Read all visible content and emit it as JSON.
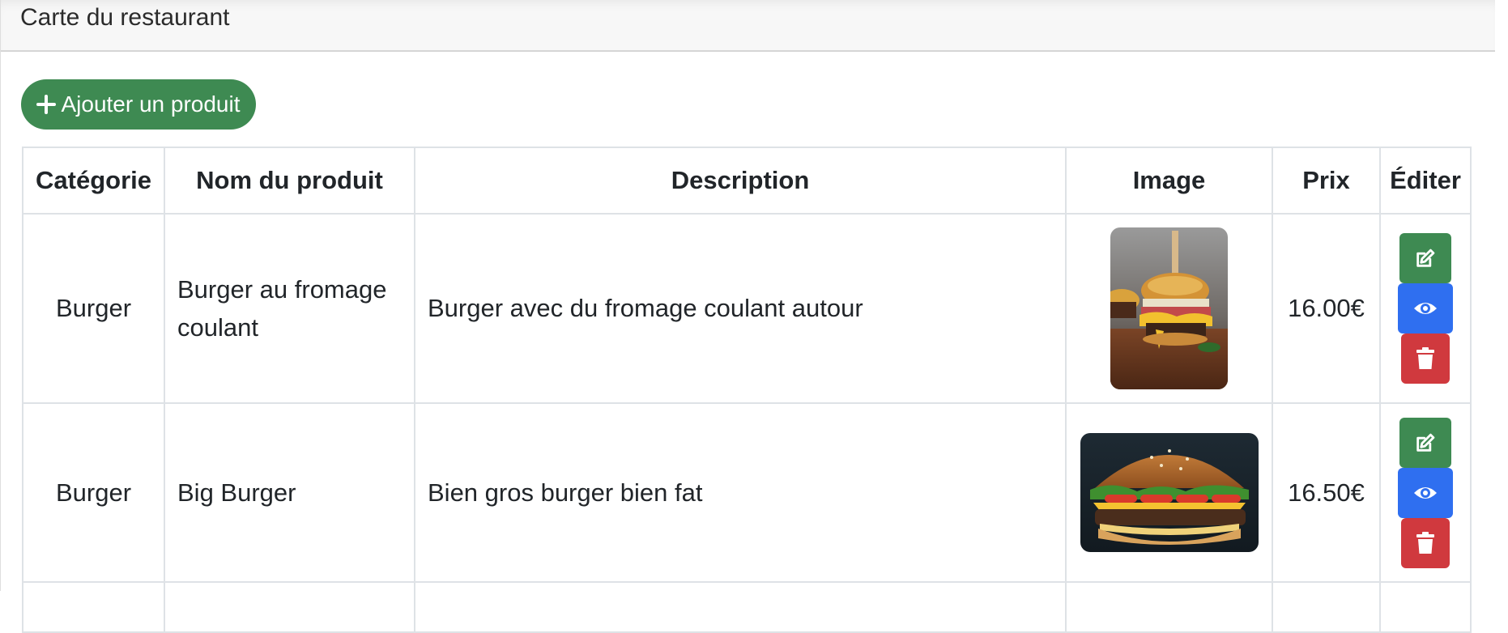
{
  "header": {
    "title": "Carte du restaurant"
  },
  "toolbar": {
    "add_label": "Ajouter un produit"
  },
  "table": {
    "columns": [
      "Catégorie",
      "Nom du produit",
      "Description",
      "Image",
      "Prix",
      "Éditer"
    ],
    "rows": [
      {
        "category": "Burger",
        "name": "Burger au fromage coulant",
        "description": "Burger avec du fromage coulant autour",
        "image": "photo of a cheeseburger with melted cheese on a wooden board",
        "price": "16.00€"
      },
      {
        "category": "Burger",
        "name": "Big Burger",
        "description": "Bien gros burger bien fat",
        "image": "photo of a large burger with lettuce, tomato and cheese",
        "price": "16.50€"
      }
    ]
  },
  "icons": {
    "add": "plus-icon",
    "edit": "edit-icon",
    "view": "eye-icon",
    "delete": "trash-icon"
  },
  "colors": {
    "primary_green": "#3e8a52",
    "view_blue": "#2f6ff0",
    "delete_red": "#d0393e",
    "header_bg": "#f7f7f7",
    "border": "#dee2e6"
  }
}
